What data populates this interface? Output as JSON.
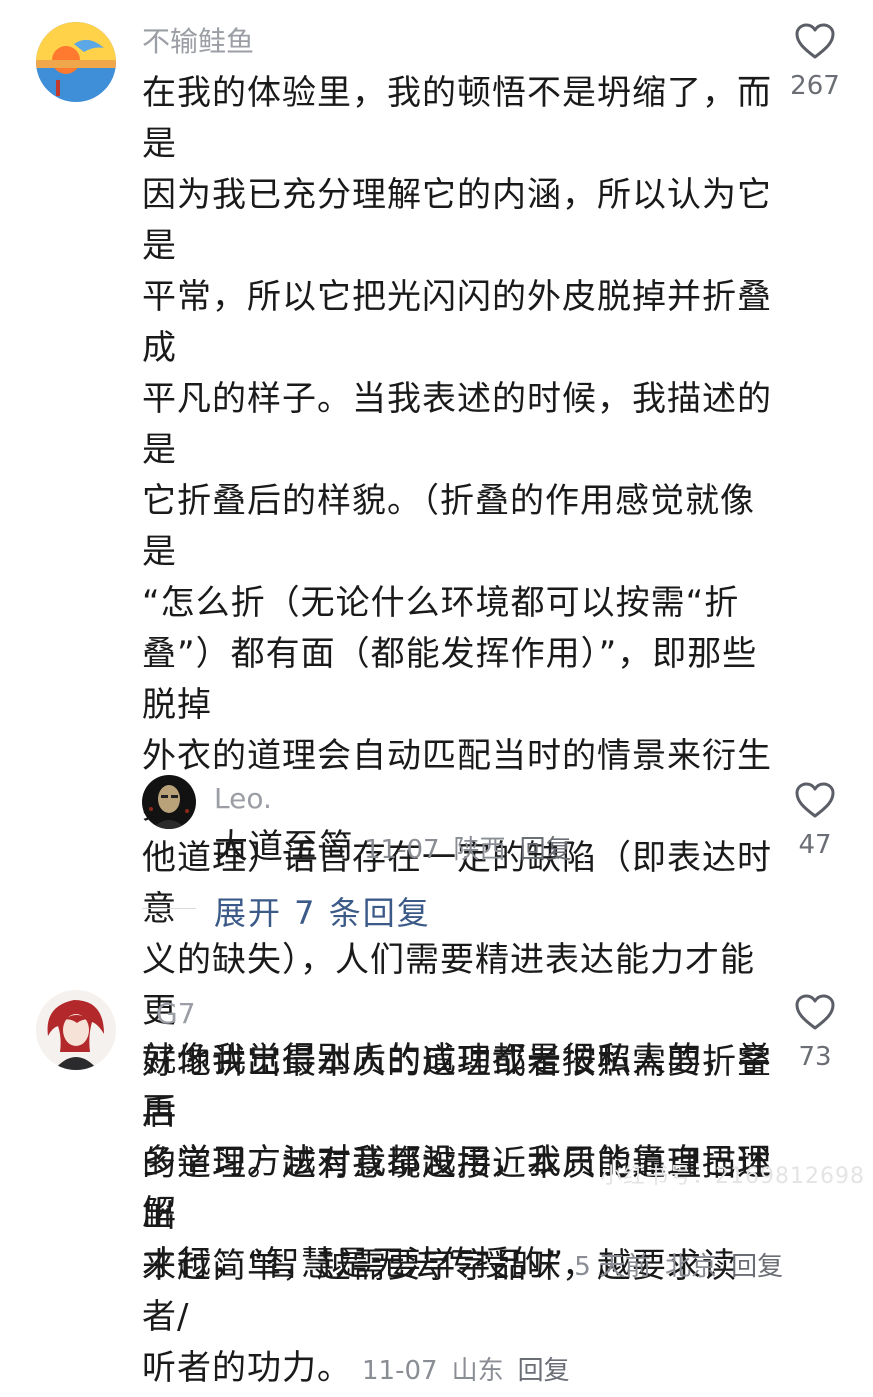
{
  "comments": [
    {
      "username": "不输鲑鱼",
      "lines": [
        "在我的体验里，我的顿悟不是坍缩了，而是",
        "因为我已充分理解它的内涵，所以认为它是",
        "平常，所以它把光闪闪的外皮脱掉并折叠成",
        "平凡的样子。当我表述的时候，我描述的是",
        "它折叠后的样貌。（折叠的作用感觉就像是",
        "“怎么折（无论什么环境都可以按需“折",
        "叠”）都有面（都能发挥作用）”，即那些脱掉",
        "外衣的道理会自动匹配当时的情景来衍生其",
        "他道理）语言存在一定的缺陷（即表达时意",
        "义的缺失），人们需要精进表达能力才能更",
        "好地讲出最本质的道理或者按照需要折叠后",
        "的道理。越有意境越接近本质的道理描述出",
        "来越简单，越需要字字品味，越要求读者/",
        "听者的功力。"
      ],
      "date": "11-07",
      "location": "山东",
      "reply_label": "回复",
      "likes": "267"
    },
    {
      "username": "Leo.",
      "text": "大道至简",
      "date": "11-07",
      "location": "陕西",
      "reply_label": "回复",
      "likes": "47"
    },
    {
      "username": "G7",
      "lines": [
        "就像我觉得别人的成功都是很私人的，学再",
        "多学习方法对我都没用，我只能靠自己理解",
        "才行，“智慧是无法传授的”"
      ],
      "date": "5 天前",
      "location": "北京",
      "reply_label": "回复",
      "likes": "73"
    }
  ],
  "expand_replies": "展开 7 条回复",
  "watermark": "小红书号：2169812698",
  "icons": {
    "like": "heart-outline-icon"
  }
}
